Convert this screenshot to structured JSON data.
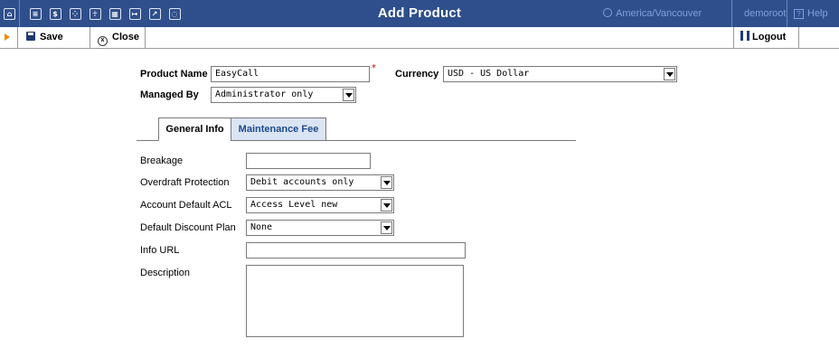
{
  "topbar": {
    "title": "Add Product",
    "timezone": "America/Vancouver",
    "user": "demoroot",
    "help_label": "Help",
    "nav_icons": [
      "home-icon",
      "list-icon",
      "dollar-icon",
      "grid-icon",
      "person-icon",
      "table-icon",
      "transfer-icon",
      "chart-icon",
      "magnifier-icon"
    ]
  },
  "toolbar": {
    "save_label": "Save",
    "close_label": "Close",
    "logout_label": "Logout"
  },
  "form": {
    "product_name_label": "Product Name",
    "product_name_value": "EasyCall",
    "required_mark": "*",
    "currency_label": "Currency",
    "currency_value": "USD - US Dollar",
    "managed_by_label": "Managed By",
    "managed_by_value": "Administrator only"
  },
  "tabs": [
    {
      "label": "General Info",
      "active": true
    },
    {
      "label": "Maintenance Fee",
      "active": false
    }
  ],
  "general_info": {
    "breakage_label": "Breakage",
    "breakage_value": "",
    "overdraft_label": "Overdraft Protection",
    "overdraft_value": "Debit accounts only",
    "acl_label": "Account Default ACL",
    "acl_value": "Access Level new",
    "discount_label": "Default Discount Plan",
    "discount_value": "None",
    "info_url_label": "Info URL",
    "info_url_value": "",
    "description_label": "Description",
    "description_value": ""
  },
  "colors": {
    "topbar_bg": "#2f4f8c",
    "topbar_muted_text": "#7fa0dc",
    "tab_inactive_bg": "#dbe4f2",
    "tab_inactive_text": "#1d4a8c",
    "accent_arrow": "#f08c00",
    "required": "#dd0000"
  }
}
